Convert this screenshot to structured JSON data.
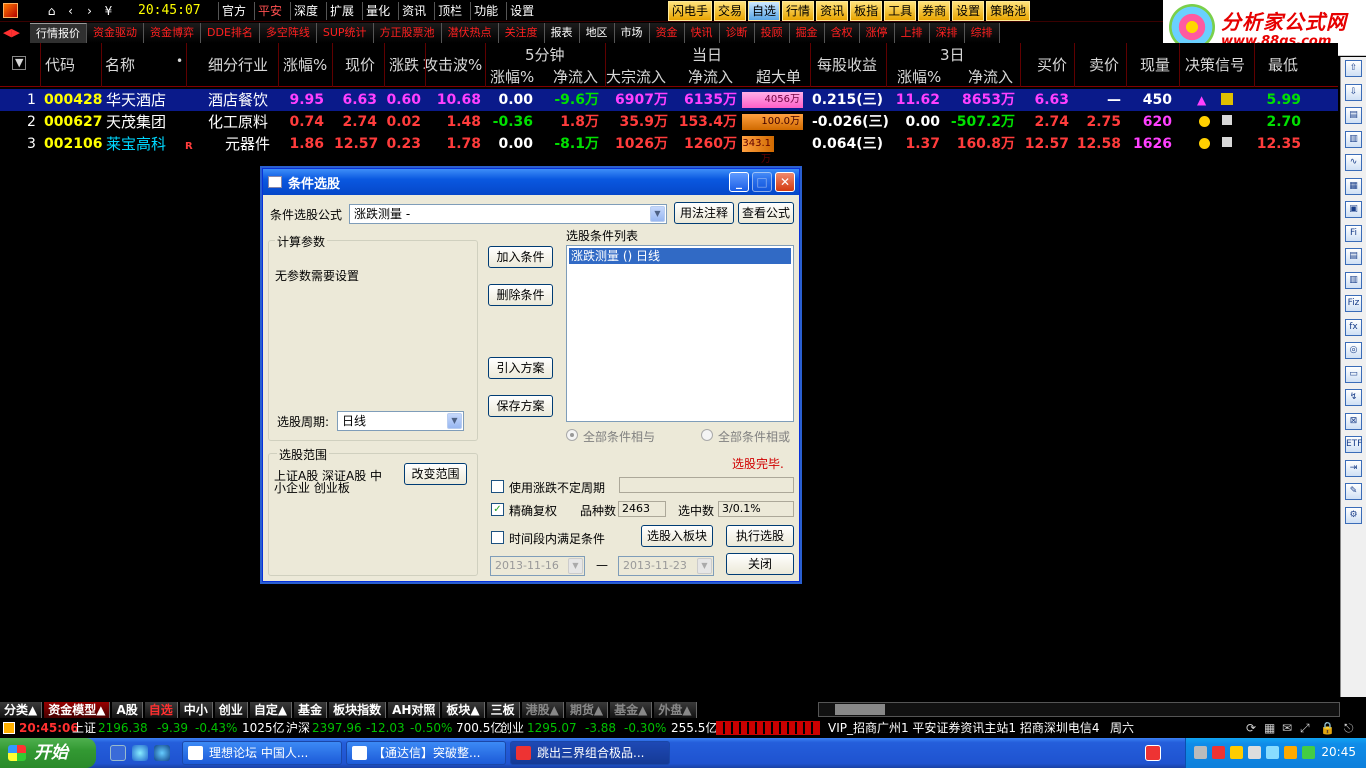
{
  "menubar": {
    "nav": [
      "⌂",
      "‹",
      "›",
      "¥"
    ],
    "clock": "20:45:07",
    "menus": [
      "官方",
      "平安",
      "深度",
      "扩展",
      "量化",
      "资讯",
      "顶栏",
      "功能",
      "设置"
    ],
    "tool_buttons": [
      "闪电手",
      "交易",
      "自选",
      "行情",
      "资讯",
      "板指",
      "工具",
      "券商",
      "设置",
      "策略池"
    ],
    "logo_title": "分析家公式网",
    "logo_url": "www.88gs.com"
  },
  "tabs": [
    "行情报价",
    "资金驱动",
    "资金博弈",
    "DDE排名",
    "多空阵线",
    "SUP统计",
    "方正股票池",
    "潜伏热点",
    "关注度",
    "报表",
    "地区",
    "市场",
    "资金",
    "快讯",
    "诊断",
    "投顾",
    "掘金",
    "含权",
    "涨停",
    "上排",
    "深排",
    "综排"
  ],
  "table": {
    "headers": {
      "code": "代码",
      "name": "名称",
      "dot": "•",
      "industry": "细分行业",
      "change_pct": "涨幅%",
      "price": "现价",
      "change": "涨跌",
      "attack": "攻击波%",
      "group_5min": "5分钟",
      "m5_pct": "涨幅%",
      "m5_flow": "净流入",
      "group_today": "当日",
      "big_flow": "大宗流入",
      "today_flow": "净流入",
      "super": "超大单",
      "eps": "每股收益",
      "group_3d": "3日",
      "d3_pct": "涨幅%",
      "d3_flow": "净流入",
      "bid": "买价",
      "ask": "卖价",
      "volume": "现量",
      "signal": "决策信号",
      "low": "最低"
    },
    "rows": [
      {
        "idx": "1",
        "code": "000428",
        "name": "华天酒店",
        "mark": "",
        "industry": "酒店餐饮",
        "change_pct": "9.95",
        "price": "6.63",
        "change": "0.60",
        "attack": "10.68",
        "m5_pct": "0.00",
        "m5_flow": "-9.6万",
        "big_flow": "6907万",
        "today_flow": "6135万",
        "super": "4056万",
        "super_level": 0.95,
        "eps": "0.215(三)",
        "d3_pct": "11.62",
        "d3_flow": "8653万",
        "bid": "6.63",
        "ask": "—",
        "volume": "450",
        "low": "5.99"
      },
      {
        "idx": "2",
        "code": "000627",
        "name": "天茂集团",
        "mark": "",
        "industry": "化工原料",
        "change_pct": "0.74",
        "price": "2.74",
        "change": "0.02",
        "attack": "1.48",
        "m5_pct": "-0.36",
        "m5_flow": "1.8万",
        "big_flow": "35.9万",
        "today_flow": "153.4万",
        "super": "100.0万",
        "super_level": 0.95,
        "eps": "-0.026(三)",
        "d3_pct": "0.00",
        "d3_flow": "-507.2万",
        "bid": "2.74",
        "ask": "2.75",
        "volume": "620",
        "low": "2.70"
      },
      {
        "idx": "3",
        "code": "002106",
        "name": "莱宝高科",
        "mark": "R",
        "industry": "元器件",
        "change_pct": "1.86",
        "price": "12.57",
        "change": "0.23",
        "attack": "1.78",
        "m5_pct": "0.00",
        "m5_flow": "-8.1万",
        "big_flow": "1026万",
        "today_flow": "1260万",
        "super": "343.1万",
        "super_level": 0.5,
        "eps": "0.064(三)",
        "d3_pct": "1.37",
        "d3_flow": "160.8万",
        "bid": "12.57",
        "ask": "12.58",
        "volume": "1626",
        "low": "12.35"
      }
    ]
  },
  "rightbar_icons": [
    "⇧",
    "⇩",
    "▤",
    "▥",
    "∿",
    "▦",
    "▣",
    "Fi",
    "▤",
    "▥",
    "Fiz",
    "fx",
    "◎",
    "▭",
    "↯",
    "⊠",
    "ETF",
    "⇥",
    "✎",
    "⚙"
  ],
  "dialog": {
    "title": "条件选股",
    "formula_label": "条件选股公式",
    "formula_value": "涨跌测量 -",
    "btn_usage": "用法注释",
    "btn_view_formula": "查看公式",
    "params_group": "计算参数",
    "params_text": "无参数需要设置",
    "period_label": "选股周期:",
    "period_value": "日线",
    "btn_add": "加入条件",
    "btn_delete": "删除条件",
    "btn_import": "引入方案",
    "btn_save": "保存方案",
    "conditions_label": "选股条件列表",
    "conditions": [
      "涨跌测量 () 日线"
    ],
    "radio_and": "全部条件相与",
    "radio_or": "全部条件相或",
    "status": "选股完毕.",
    "scope_group": "选股范围",
    "scope_text_1": "上证A股 深证A股 中",
    "scope_text_2": "小企业 创业板",
    "btn_change_scope": "改变范围",
    "chk_period": "使用涨跌不定周期",
    "chk_exact": "精确复权",
    "count_label": "品种数",
    "count_value": "2463",
    "selected_label": "选中数",
    "selected_value": "3/0.1%",
    "chk_time": "时间段内满足条件",
    "btn_to_block": "选股入板块",
    "btn_execute": "执行选股",
    "date_from": "2013-11-16",
    "date_sep": "—",
    "date_to": "2013-11-23",
    "btn_close": "关闭"
  },
  "categories": [
    {
      "label": "分类▲",
      "style": ""
    },
    {
      "label": "资金模型▲",
      "style": "active"
    },
    {
      "label": "A股",
      "style": ""
    },
    {
      "label": "自选",
      "style": "red"
    },
    {
      "label": "中小",
      "style": ""
    },
    {
      "label": "创业",
      "style": ""
    },
    {
      "label": "自定▲",
      "style": ""
    },
    {
      "label": "基金",
      "style": ""
    },
    {
      "label": "板块指数",
      "style": ""
    },
    {
      "label": "AH对照",
      "style": ""
    },
    {
      "label": "板块▲",
      "style": ""
    },
    {
      "label": "三板",
      "style": ""
    },
    {
      "label": "港股▲",
      "style": "gray"
    },
    {
      "label": "期货▲",
      "style": "gray"
    },
    {
      "label": "基金▲",
      "style": "gray"
    },
    {
      "label": "外盘▲",
      "style": "gray"
    }
  ],
  "statusbar": {
    "time": "20:45:06",
    "sh_label": "上证",
    "sh_index": "2196.38",
    "sh_change": "-9.39",
    "sh_pct": "-0.43%",
    "sh_amount": "1025亿",
    "sz_label": "沪深",
    "sz_index": "2397.96",
    "sz_change": "-12.03",
    "sz_pct": "-0.50%",
    "sz_amount": "700.5亿",
    "cy_label": "创业",
    "cy_index": "1295.07",
    "cy_change": "-3.88",
    "cy_pct": "-0.30%",
    "cy_amount": "255.5亿",
    "servers": "VIP_招商广州1  平安证券资讯主站1  招商深圳电信4",
    "weekday": "周六"
  },
  "taskbar": {
    "start": "开始",
    "tasks": [
      "理想论坛 中国人...",
      "【通达信】突破整...",
      "跳出三界组合极品..."
    ],
    "clock": "20:45"
  },
  "colors": {
    "red": "#ff3c3c",
    "green": "#00e000",
    "yellow": "#ffff00",
    "cyan": "#00d8ff",
    "magenta": "#ff40ff",
    "white": "#ffffff"
  }
}
